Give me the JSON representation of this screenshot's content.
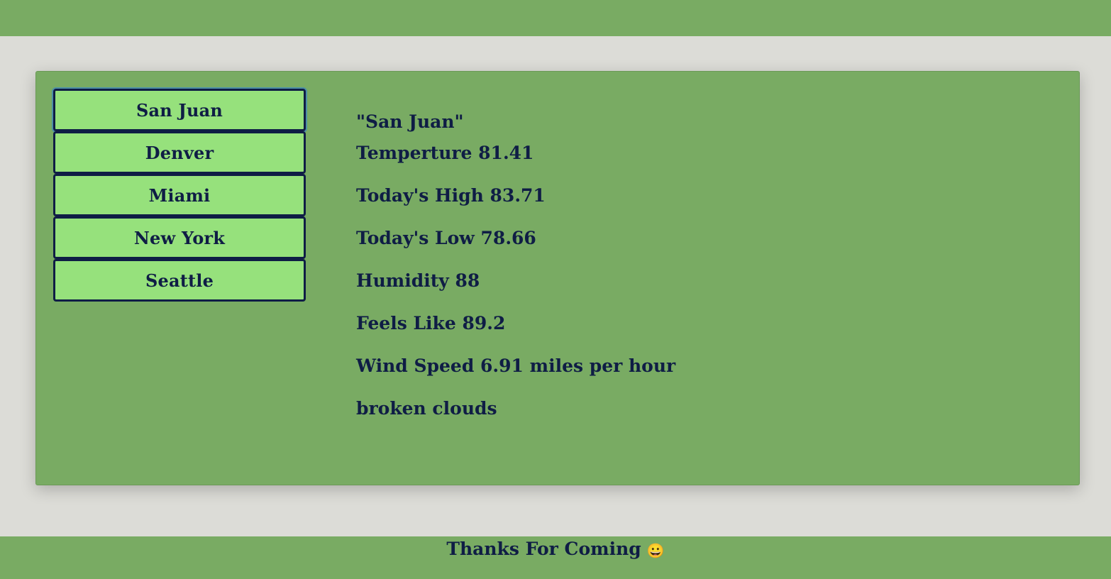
{
  "colors": {
    "page_background": "#dcdcd7",
    "panel_background": "#79ab63",
    "button_background": "#96e17c",
    "text": "#0f1d45"
  },
  "cities": [
    "San Juan",
    "Denver",
    "Miami",
    "New York",
    "Seattle"
  ],
  "selected_city": "San Juan",
  "weather": {
    "city_title": "\"San Juan\"",
    "temperature": "Temperture 81.41",
    "high": "Today's High 83.71",
    "low": "Today's Low 78.66",
    "humidity": "Humidity 88",
    "feels_like": "Feels Like 89.2",
    "wind": "Wind Speed 6.91 miles per hour",
    "description": "broken clouds"
  },
  "footer": {
    "text": "Thanks For Coming",
    "icon": "smiling-face-emoji",
    "icon_glyph": "😀"
  }
}
